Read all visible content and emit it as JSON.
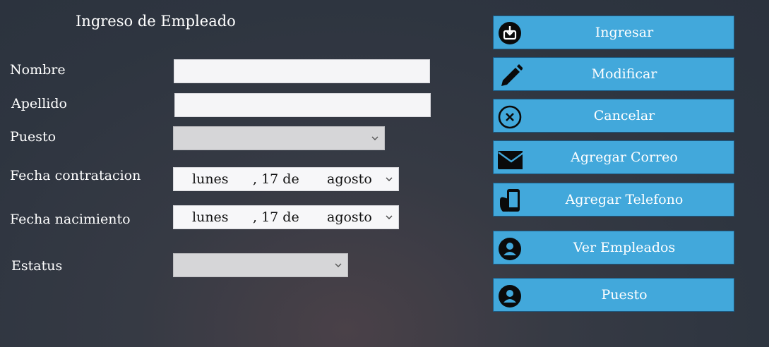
{
  "form": {
    "title": "Ingreso de Empleado",
    "labels": {
      "nombre": "Nombre",
      "apellido": "Apellido",
      "puesto": "Puesto",
      "fecha_contratacion": "Fecha contratacion",
      "fecha_nacimiento": "Fecha nacimiento",
      "estatus": "Estatus"
    },
    "nombre_value": "",
    "apellido_value": "",
    "puesto_selected": "",
    "estatus_selected": "",
    "fecha_contratacion": {
      "day_name": "lunes",
      "sep": ", 17 de",
      "month": "agosto"
    },
    "fecha_nacimiento": {
      "day_name": "lunes",
      "sep": ", 17 de",
      "month": "agosto"
    }
  },
  "buttons": {
    "ingresar": "Ingresar",
    "modificar": "Modificar",
    "cancelar": "Cancelar",
    "agregar_correo": "Agregar Correo",
    "agregar_telefono": "Agregar Telefono",
    "ver_empleados": "Ver Empleados",
    "puesto": "Puesto"
  },
  "icons": {
    "ingresar": "download-icon",
    "modificar": "pencil-icon",
    "cancelar": "close-circle-icon",
    "agregar_correo": "envelope-icon",
    "agregar_telefono": "phone-hand-icon",
    "ver_empleados": "user-icon",
    "puesto": "user-icon"
  },
  "colors": {
    "button_bg": "#42a8db",
    "button_border": "#1b5c86",
    "background": "#2e3540"
  }
}
